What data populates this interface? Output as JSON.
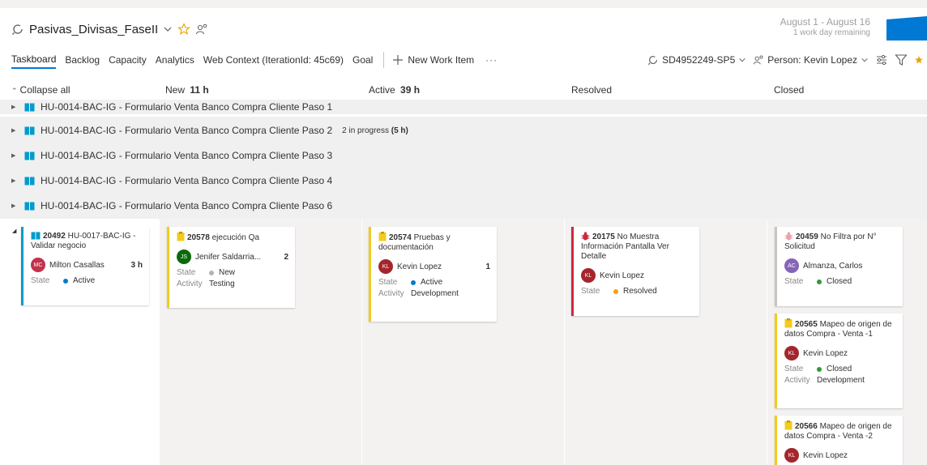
{
  "header": {
    "sprint_name": "Pasivas_Divisas_FaseII",
    "sprint_range": "August 1 - August 16",
    "sprint_remaining": "1 work day remaining"
  },
  "tabs": [
    {
      "label": "Taskboard"
    },
    {
      "label": "Backlog"
    },
    {
      "label": "Capacity"
    },
    {
      "label": "Analytics"
    },
    {
      "label": "Web Context (IterationId: 45c69)"
    },
    {
      "label": "Goal"
    }
  ],
  "toolbar": {
    "new_work_item": "New Work Item",
    "more": "···",
    "sprint_selector": "SD4952249-SP5",
    "person_filter": "Person: Kevin Lopez"
  },
  "columns": {
    "collapse_all": "Collapse all",
    "new_label": "New",
    "new_hours": "11 h",
    "active_label": "Active",
    "active_hours": "39 h",
    "resolved_label": "Resolved",
    "closed_label": "Closed"
  },
  "groups": [
    {
      "title": "HU-0014-BAC-IG - Formulario Venta Banco Compra Cliente Paso 1",
      "progress": ""
    },
    {
      "title": "HU-0014-BAC-IG - Formulario Venta Banco Compra Cliente Paso 2",
      "progress": "2 in progress",
      "progress_hours": "(5 h)"
    },
    {
      "title": "HU-0014-BAC-IG - Formulario Venta Banco Compra Cliente Paso 3",
      "progress": ""
    },
    {
      "title": "HU-0014-BAC-IG - Formulario Venta Banco Compra Cliente Paso 4",
      "progress": ""
    },
    {
      "title": "HU-0014-BAC-IG - Formulario Venta Banco Compra Cliente Paso 6",
      "progress": ""
    }
  ],
  "labels": {
    "state": "State",
    "activity": "Activity"
  },
  "cards": {
    "parent": {
      "id": "20492",
      "title": "HU-0017-BAC-IG - Validar negocio",
      "initials": "MC",
      "assignee": "Milton Casallas",
      "remaining": "3 h",
      "state": "Active",
      "color": "#009ccc",
      "avatar_color": "#c4314b"
    },
    "new1": {
      "id": "20578",
      "title": "ejecución Qa",
      "initials": "JS",
      "assignee": "Jenifer Saldarria...",
      "remaining": "2",
      "state": "New",
      "activity": "Testing",
      "color": "#f2cb1d",
      "avatar_color": "#0b6a0b"
    },
    "active1": {
      "id": "20574",
      "title": "Pruebas y documentación",
      "initials": "KL",
      "assignee": "Kevin Lopez",
      "remaining": "1",
      "state": "Active",
      "activity": "Development",
      "color": "#f2cb1d",
      "avatar_color": "#a4262c"
    },
    "resolved1": {
      "id": "20175",
      "title": "No Muestra Información Pantalla Ver Detalle",
      "initials": "KL",
      "assignee": "Kevin Lopez",
      "state": "Resolved",
      "color": "#cc293d",
      "avatar_color": "#a4262c"
    },
    "closed1": {
      "id": "20459",
      "title": "No Filtra por N° Solicitud",
      "initials": "AC",
      "assignee": "Almanza, Carlos",
      "state": "Closed",
      "color": "#c8c6c4",
      "avatar_color": "#8764b8"
    },
    "closed2": {
      "id": "20565",
      "title": "Mapeo de origen de datos Compra - Venta -1",
      "initials": "KL",
      "assignee": "Kevin Lopez",
      "state": "Closed",
      "activity": "Development",
      "color": "#f2cb1d",
      "avatar_color": "#a4262c"
    },
    "closed3": {
      "id": "20566",
      "title": "Mapeo de origen de datos Compra - Venta -2",
      "initials": "KL",
      "assignee": "Kevin Lopez",
      "color": "#f2cb1d",
      "avatar_color": "#a4262c"
    }
  },
  "colors": {
    "accent": "#0078d4",
    "active": "#007acc",
    "new": "#b2b2b2",
    "resolved": "#ff9d00",
    "closed": "#339933",
    "favorite": "#e8a200"
  },
  "icons": [
    "sprint-icon",
    "chevron-down-icon",
    "star-icon",
    "person-icon",
    "plus-icon",
    "filter-icon",
    "settings-icon",
    "book-icon",
    "task-icon",
    "bug-icon",
    "burndown-chart"
  ]
}
